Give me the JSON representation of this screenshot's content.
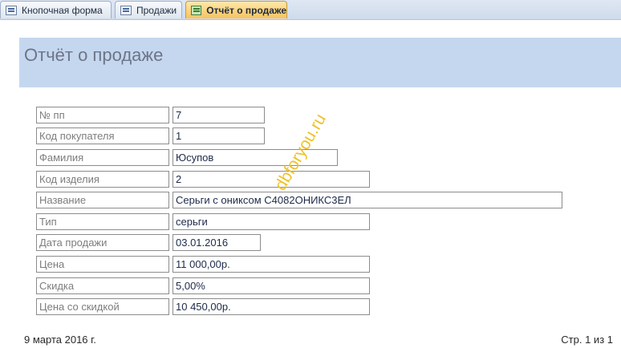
{
  "tabs": [
    {
      "label": "Кнопочная форма",
      "icon": "form-icon"
    },
    {
      "label": "Продажи",
      "icon": "form-icon"
    },
    {
      "label": "Отчёт о продаже",
      "icon": "report-icon",
      "active": true
    }
  ],
  "report": {
    "title": "Отчёт о продаже",
    "fields": [
      {
        "label": "№ пп",
        "value": "7"
      },
      {
        "label": "Код покупателя",
        "value": "1"
      },
      {
        "label": "Фамилия",
        "value": "Юсупов"
      },
      {
        "label": "Код изделия",
        "value": "2"
      },
      {
        "label": "Название",
        "value": "Серьги с ониксом С4082ОНИКС3ЕЛ"
      },
      {
        "label": "Тип",
        "value": "серьги"
      },
      {
        "label": "Дата продажи",
        "value": "03.01.2016"
      },
      {
        "label": "Цена",
        "value": "11 000,00р."
      },
      {
        "label": "Скидка",
        "value": "5,00%"
      },
      {
        "label": "Цена со скидкой",
        "value": "10 450,00р."
      }
    ],
    "footer_date": "9 марта 2016 г.",
    "footer_page": "Стр. 1 из 1"
  },
  "watermark": "dbforyou.ru",
  "colors": {
    "header_band": "#c5d7ef",
    "active_tab": "#f7c35f",
    "watermark": "#f0c22a"
  }
}
